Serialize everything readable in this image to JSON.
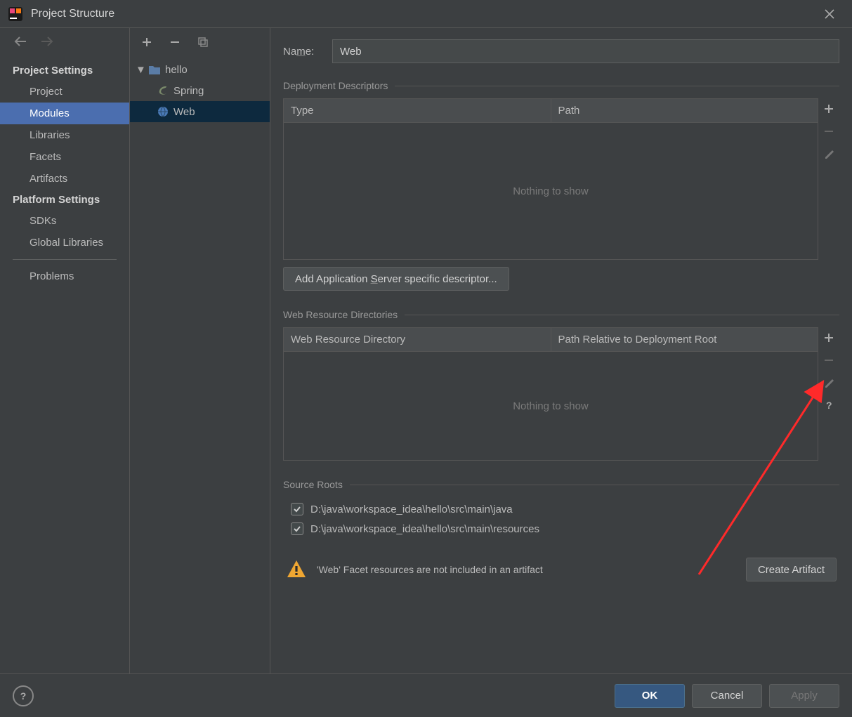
{
  "window": {
    "title": "Project Structure"
  },
  "sidebar": {
    "section1": "Project Settings",
    "section2": "Platform Settings",
    "items": {
      "project": "Project",
      "modules": "Modules",
      "libraries": "Libraries",
      "facets": "Facets",
      "artifacts": "Artifacts",
      "sdks": "SDKs",
      "global_libraries": "Global Libraries",
      "problems": "Problems"
    }
  },
  "tree": {
    "root": "hello",
    "children": {
      "spring": "Spring",
      "web": "Web"
    }
  },
  "detail": {
    "name_label_pre": "Na",
    "name_label_u": "m",
    "name_label_post": "e:",
    "name_value": "Web",
    "deploy_descriptors": {
      "title": "Deployment Descriptors",
      "col_type": "Type",
      "col_path": "Path",
      "empty": "Nothing to show",
      "add_button_pre": "Add Application ",
      "add_button_u": "S",
      "add_button_post": "erver specific descriptor..."
    },
    "web_resource": {
      "title": "Web Resource Directories",
      "col_dir": "Web Resource Directory",
      "col_path": "Path Relative to Deployment Root",
      "empty": "Nothing to show"
    },
    "source_roots": {
      "title": "Source Roots",
      "rows": [
        "D:\\java\\workspace_idea\\hello\\src\\main\\java",
        "D:\\java\\workspace_idea\\hello\\src\\main\\resources"
      ]
    },
    "warning_text": "'Web' Facet resources are not included in an artifact",
    "create_artifact": "Create Artifact"
  },
  "buttons": {
    "ok": "OK",
    "cancel": "Cancel",
    "apply": "Apply"
  }
}
